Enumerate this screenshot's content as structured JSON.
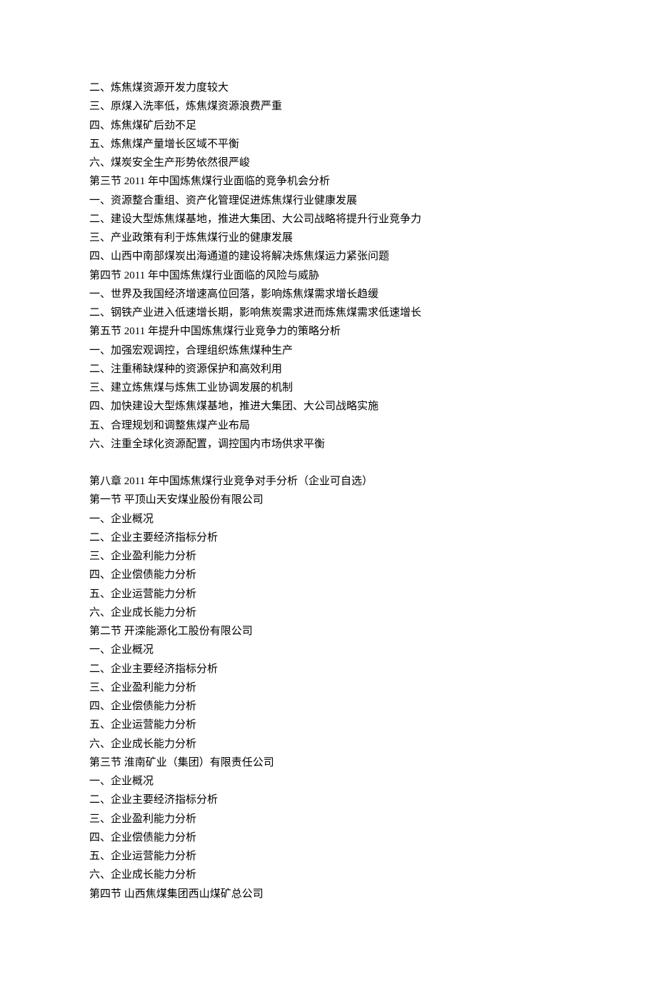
{
  "lines": [
    "二、炼焦煤资源开发力度较大",
    "三、原煤入洗率低，炼焦煤资源浪费严重",
    "四、炼焦煤矿后劲不足",
    "五、炼焦煤产量增长区域不平衡",
    "六、煤炭安全生产形势依然很严峻",
    "第三节 2011 年中国炼焦煤行业面临的竞争机会分析",
    "一、资源整合重组、资产化管理促进炼焦煤行业健康发展",
    "二、建设大型炼焦煤基地，推进大集团、大公司战略将提升行业竞争力",
    "三、产业政策有利于炼焦煤行业的健康发展",
    "四、山西中南部煤炭出海通道的建设将解决炼焦煤运力紧张问题",
    "第四节 2011 年中国炼焦煤行业面临的风险与威胁",
    "一、世界及我国经济增速高位回落，影响炼焦煤需求增长趋缓",
    "二、钢铁产业进入低速增长期，影响焦炭需求进而炼焦煤需求低速增长",
    "第五节 2011 年提升中国炼焦煤行业竞争力的策略分析",
    "一、加强宏观调控，合理组织炼焦煤种生产",
    "二、注重稀缺煤种的资源保护和高效利用",
    "三、建立炼焦煤与炼焦工业协调发展的机制",
    "四、加快建设大型炼焦煤基地，推进大集团、大公司战略实施",
    "五、合理规划和调整焦煤产业布局",
    "六、注重全球化资源配置，调控国内市场供求平衡",
    "",
    "第八章 2011 年中国炼焦煤行业竞争对手分析（企业可自选）",
    "第一节  平顶山天安煤业股份有限公司",
    "一、企业概况",
    "二、企业主要经济指标分析",
    "三、企业盈利能力分析",
    "四、企业偿债能力分析",
    "五、企业运营能力分析",
    "六、企业成长能力分析",
    "第二节  开滦能源化工股份有限公司",
    "一、企业概况",
    "二、企业主要经济指标分析",
    "三、企业盈利能力分析",
    "四、企业偿债能力分析",
    "五、企业运营能力分析",
    "六、企业成长能力分析",
    "第三节  淮南矿业（集团）有限责任公司",
    "一、企业概况",
    "二、企业主要经济指标分析",
    "三、企业盈利能力分析",
    "四、企业偿债能力分析",
    "五、企业运营能力分析",
    "六、企业成长能力分析",
    "第四节  山西焦煤集团西山煤矿总公司"
  ]
}
